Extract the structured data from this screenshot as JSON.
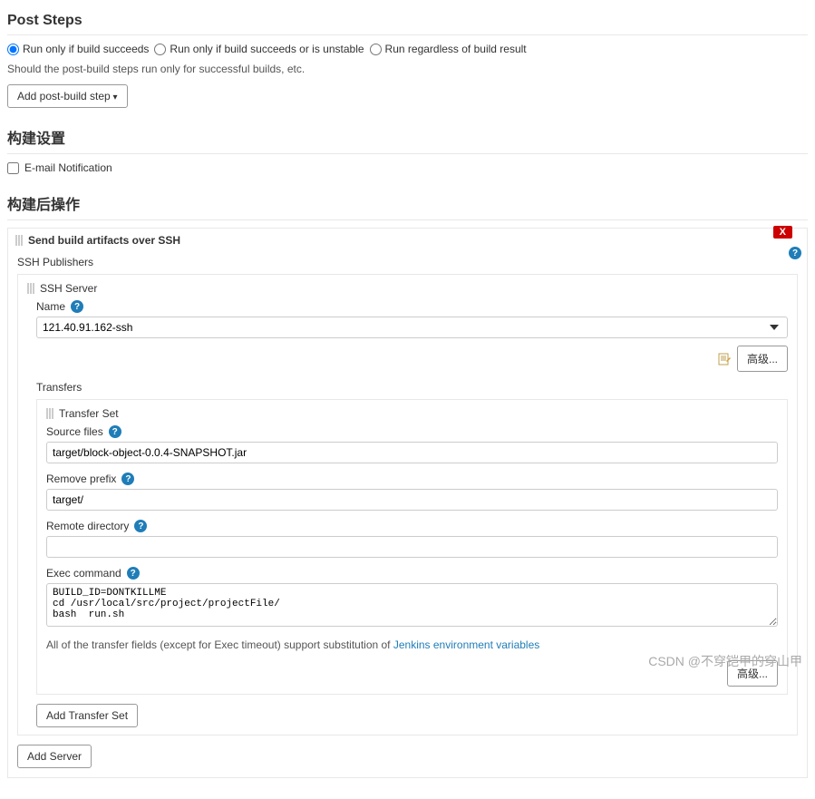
{
  "postSteps": {
    "title": "Post Steps",
    "radios": {
      "successOnly": "Run only if build succeeds",
      "successOrUnstable": "Run only if build succeeds or is unstable",
      "regardless": "Run regardless of build result"
    },
    "helpText": "Should the post-build steps run only for successful builds, etc.",
    "addButton": "Add post-build step"
  },
  "buildSettings": {
    "title": "构建设置",
    "emailNotification": "E-mail Notification"
  },
  "postBuildActions": {
    "title": "构建后操作",
    "publisher": {
      "title": "Send build artifacts over SSH",
      "deleteLabel": "X",
      "sshPublishersLabel": "SSH Publishers",
      "sshServer": {
        "title": "SSH Server",
        "nameLabel": "Name",
        "nameValue": "121.40.91.162-ssh",
        "advancedLabel": "高级..."
      },
      "transfers": {
        "title": "Transfers",
        "transferSetLabel": "Transfer Set",
        "sourceFiles": {
          "label": "Source files",
          "value": "target/block-object-0.0.4-SNAPSHOT.jar"
        },
        "removePrefix": {
          "label": "Remove prefix",
          "value": "target/"
        },
        "remoteDirectory": {
          "label": "Remote directory",
          "value": ""
        },
        "execCommand": {
          "label": "Exec command",
          "value": "BUILD_ID=DONTKILLME\ncd /usr/local/src/project/projectFile/\nbash  run.sh"
        },
        "hintPrefix": "All of the transfer fields (except for Exec timeout) support substitution of ",
        "hintLink": "Jenkins environment variables",
        "advancedLabel": "高级...",
        "addTransferSet": "Add Transfer Set"
      },
      "addServer": "Add Server"
    }
  },
  "watermark": "CSDN @不穿铠甲的穿山甲"
}
